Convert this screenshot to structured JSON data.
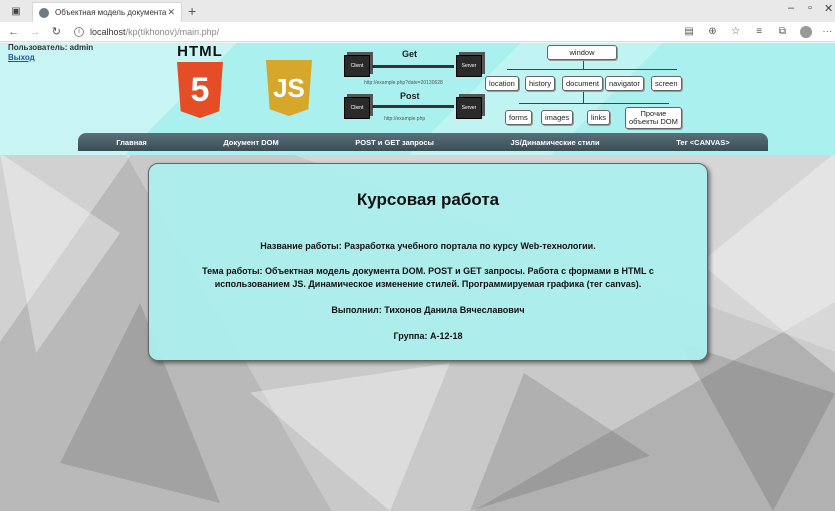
{
  "browser": {
    "tab_title": "Объектная модель документа",
    "tab_close": "✕",
    "new_tab": "+",
    "url_host": "localhost",
    "url_path": "/kp(tikhonov)/main.php/"
  },
  "header": {
    "user_label": "Пользователь: admin",
    "logout": "Выход",
    "html_word": "HTML",
    "html_glyph": "5",
    "js_glyph": "JS"
  },
  "diagram": {
    "get_label": "Get",
    "post_label": "Post",
    "client": "Client",
    "server": "Server",
    "get_url": "http://example.php?date=20130628",
    "post_url": "http://example.php"
  },
  "dom_tree": {
    "root": "window",
    "level1": [
      "location",
      "history",
      "document",
      "navigator",
      "screen"
    ],
    "level2": [
      "forms",
      "images",
      "links"
    ],
    "other_line1": "Прочие",
    "other_line2": "объекты DOM"
  },
  "menu": {
    "items": [
      "Главная",
      "Документ DOM",
      "POST и GET запросы",
      "JS/Динамические стили",
      "Тег <CANVAS>"
    ]
  },
  "card": {
    "title": "Курсовая работа",
    "work_name": "Название работы: Разработка учебного портала по курсу Web-технологии.",
    "topic": "Тема работы: Объектная модель документа DOM. POST и GET запросы. Работа с формами в HTML с использованием JS. Динамическое изменение стилей. Программируемая графика (тег canvas).",
    "author": "Выполнил: Тихонов Данила Вячеславович",
    "group": "Группа: А-12-18"
  }
}
